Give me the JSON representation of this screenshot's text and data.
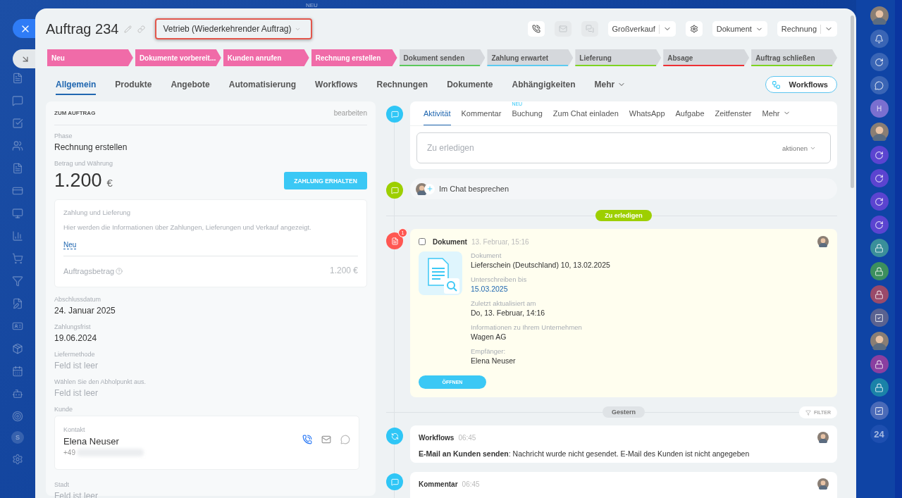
{
  "top_badge": "NEU",
  "left_nav": [
    {
      "kind": "doc"
    },
    {
      "kind": "chat"
    },
    {
      "kind": "task"
    },
    {
      "kind": "contacts"
    },
    {
      "kind": "doc"
    },
    {
      "kind": "card"
    },
    {
      "kind": "monitor"
    },
    {
      "kind": "chart"
    },
    {
      "kind": "cart"
    },
    {
      "kind": "filter"
    },
    {
      "kind": "edit"
    },
    {
      "kind": "id"
    },
    {
      "kind": "box"
    },
    {
      "kind": "calendar"
    },
    {
      "kind": "robot"
    },
    {
      "kind": "target"
    },
    {
      "kind": "letter",
      "text": "S"
    },
    {
      "kind": "settings"
    }
  ],
  "header": {
    "title": "Auftrag 234",
    "category": "Vetrieb (Wiederkehrender Auftrag)",
    "highlighted": true,
    "actions": [
      {
        "kind": "phone",
        "disabled": false
      },
      {
        "kind": "mail",
        "disabled": true
      },
      {
        "kind": "chat",
        "disabled": true
      },
      {
        "kind": "split",
        "label": "Großverkauf"
      },
      {
        "kind": "settings",
        "disabled": false
      },
      {
        "kind": "menu",
        "label": "Dokument"
      },
      {
        "kind": "split",
        "label": "Rechnung"
      }
    ]
  },
  "stages": [
    {
      "label": "Neu",
      "passed": true,
      "color": "#f06ba8"
    },
    {
      "label": "Dokumente vorbereit...",
      "passed": true,
      "color": "#f06ba8"
    },
    {
      "label": "Kunden anrufen",
      "passed": true,
      "color": "#f06ba8"
    },
    {
      "label": "Rechnung erstellen",
      "passed": true,
      "color": "#f06ba8"
    },
    {
      "label": "Dokument senden",
      "passed": false,
      "color": "#5bc85b"
    },
    {
      "label": "Zahlung erwartet",
      "passed": false,
      "color": "#5ccbf0"
    },
    {
      "label": "Lieferung",
      "passed": false,
      "color": "#7ed321"
    },
    {
      "label": "Absage",
      "passed": false,
      "color": "#ee2f34"
    },
    {
      "label": "Auftrag schließen",
      "passed": false,
      "color": "#7ed321"
    }
  ],
  "tabs": [
    {
      "label": "Allgemein",
      "selected": true,
      "kind": "tab"
    },
    {
      "label": "Produkte",
      "selected": false,
      "kind": "tab"
    },
    {
      "label": "Angebote",
      "selected": false,
      "kind": "tab"
    },
    {
      "label": "Automatisierung",
      "selected": false,
      "kind": "tab"
    },
    {
      "label": "Workflows",
      "selected": false,
      "kind": "tab"
    },
    {
      "label": "Rechnungen",
      "selected": false,
      "kind": "tab"
    },
    {
      "label": "Dokumente",
      "selected": false,
      "kind": "tab"
    },
    {
      "label": "Abhängigkeiten",
      "selected": false,
      "kind": "tab"
    },
    {
      "label": "Mehr",
      "selected": false,
      "kind": "more"
    }
  ],
  "workflows_button": "Workflows",
  "order_card": {
    "title": "ZUM AUFTRAG",
    "edit": "bearbeiten",
    "phase": {
      "label": "Phase",
      "value": "Rechnung erstellen"
    },
    "amount": {
      "label": "Betrag und Währung",
      "value": "1.200",
      "currency": "€",
      "button": "ZAHLUNG ERHALTEN"
    },
    "payment_box": {
      "title": "Zahlung und Lieferung",
      "text": "Hier werden die Informationen über Zahlungen, Lieferungen und Verkauf angezeigt.",
      "link": "Neu",
      "total_label": "Auftragsbetrag",
      "total": "1.200 €"
    },
    "fields": [
      {
        "label": "Abschlussdatum",
        "value": "24. Januar 2025"
      },
      {
        "label": "Zahlungsfrist",
        "value": "19.06.2024"
      },
      {
        "label": "Liefermethode",
        "placeholder": "Feld ist leer"
      },
      {
        "label": "Wählen Sie den Abholpunkt aus.",
        "placeholder": "Feld ist leer"
      }
    ],
    "customer": {
      "label": "Kunde",
      "role": "Kontakt",
      "name": "Elena Neuser",
      "phone": "+49"
    },
    "more_fields": [
      {
        "label": "Stadt",
        "placeholder": "Feld ist leer"
      }
    ]
  },
  "activity_tabs": [
    {
      "label": "Aktivität",
      "selected": true,
      "kind": "tab"
    },
    {
      "label": "Kommentar",
      "selected": false,
      "kind": "tab"
    },
    {
      "label": "Buchung",
      "selected": false,
      "kind": "tab",
      "badge": "NEU"
    },
    {
      "label": "Zum Chat einladen",
      "selected": false,
      "kind": "tab"
    },
    {
      "label": "WhatsApp",
      "selected": false,
      "kind": "tab"
    },
    {
      "label": "Aufgabe",
      "selected": false,
      "kind": "tab"
    },
    {
      "label": "Zeitfenster",
      "selected": false,
      "kind": "tab"
    },
    {
      "label": "Mehr",
      "selected": false,
      "kind": "more"
    }
  ],
  "editor": {
    "placeholder": "Zu erledigen",
    "actions": "aktionen"
  },
  "chat": {
    "label": "Im Chat besprechen"
  },
  "todo_divider": "Zu erledigen",
  "document": {
    "checked": false,
    "title": "Dokument",
    "time": "13. Februar, 15:16",
    "badge": "1",
    "fields": [
      {
        "label": "Dokument",
        "value": "Lieferschein (Deutschland) 10, 13.02.2025",
        "kind": "text"
      },
      {
        "label": "Unterschreiben bis",
        "value": "15.03.2025",
        "kind": "link"
      },
      {
        "label": "Zuletzt aktualisiert am",
        "value": "Do, 13. Februar, 14:16",
        "kind": "text"
      },
      {
        "label": "Informationen zu Ihrem Unternehmen",
        "value": "Wagen AG",
        "kind": "text"
      },
      {
        "label": "Empfänger:",
        "value": "Elena Neuser",
        "kind": "text"
      }
    ],
    "button": "ÖFFNEN"
  },
  "day_divider": "Gestern",
  "filter": "FILTER",
  "events": [
    {
      "kind": "workflow",
      "title": "Workflows",
      "time": "06:45",
      "text": "**E-Mail an Kunden senden**: Nachricht wurde nicht gesendet. E-Mail des Kunden ist nicht angegeben"
    },
    {
      "kind": "comment",
      "title": "Kommentar",
      "time": "06:45"
    }
  ],
  "right_bar": [
    {
      "kind": "avatar"
    },
    {
      "kind": "bell"
    },
    {
      "kind": "sync"
    },
    {
      "kind": "chat"
    },
    {
      "kind": "letter",
      "text": "H",
      "color": "#7a6fd0"
    },
    {
      "kind": "avatar"
    },
    {
      "kind": "sync",
      "color": "#5b44d0"
    },
    {
      "kind": "sync",
      "color": "#5b44d0"
    },
    {
      "kind": "sync",
      "color": "#5b44d0"
    },
    {
      "kind": "sync",
      "color": "#5b44d0"
    },
    {
      "kind": "lock",
      "color": "#3a8f9a"
    },
    {
      "kind": "lock",
      "color": "#3c8f5e"
    },
    {
      "kind": "lock",
      "color": "#9a4a6a"
    },
    {
      "kind": "check",
      "color": "#5a6290"
    },
    {
      "kind": "avatar"
    },
    {
      "kind": "lock",
      "color": "#8a3fa0"
    },
    {
      "kind": "lock",
      "color": "#1a82a8"
    },
    {
      "kind": "check",
      "color": "#4a6ab8"
    },
    {
      "kind": "letter",
      "text": "24",
      "color": "#1e4fb0"
    }
  ]
}
